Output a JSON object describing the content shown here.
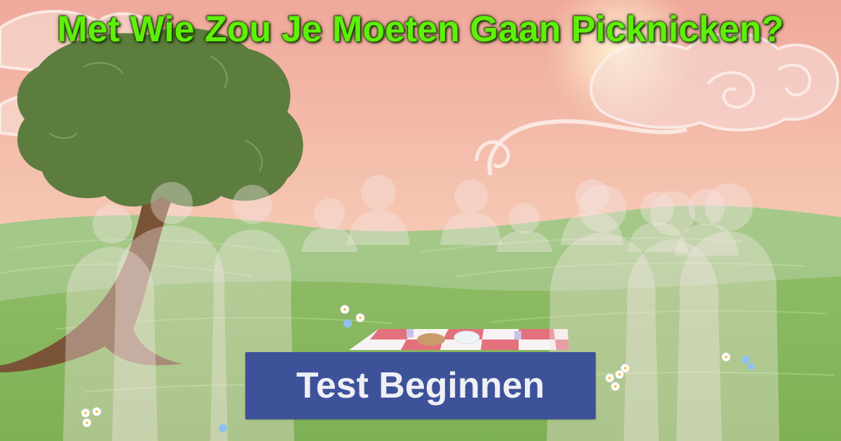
{
  "header": {
    "title": "Met Wie Zou Je Moeten Gaan Picknicken?"
  },
  "cta": {
    "label": "Test Beginnen",
    "background_color": "#3e529a",
    "text_color": "#eef0f5"
  },
  "colors": {
    "title_green": "#5ef00a",
    "sky_top": "#f2b8a9",
    "grass": "#8fbf64"
  },
  "illustration": {
    "subject": "tree-icon",
    "group": "people-silhouettes-icon",
    "blanket": "picnic-blanket-icon"
  }
}
